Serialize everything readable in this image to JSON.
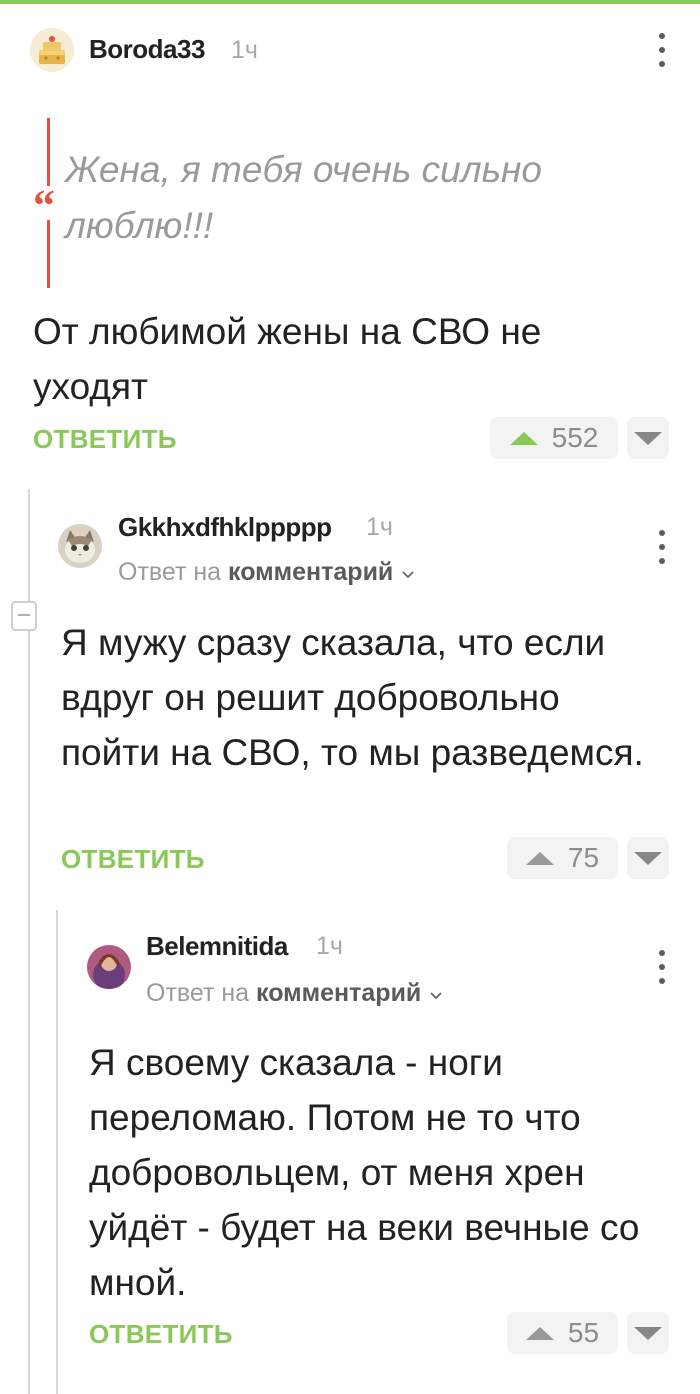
{
  "comments": [
    {
      "username": "Boroda33",
      "time": "1ч",
      "quote": "Жена, я тебя очень сильно люблю!!!",
      "text": "От любимой жены на СВО не уходят",
      "reply_label": "ОТВЕТИТЬ",
      "rating": "552"
    },
    {
      "username": "Gkkhxdfhklppppp",
      "time": "1ч",
      "reply_to_prefix": "Ответ на",
      "reply_to_link": "комментарий",
      "text": "Я мужу сразу сказала, что если вдруг он решит добровольно пойти на СВО, то мы разведемся.",
      "reply_label": "ОТВЕТИТЬ",
      "rating": "75"
    },
    {
      "username": "Belemnitida",
      "time": "1ч",
      "reply_to_prefix": "Ответ на",
      "reply_to_link": "комментарий",
      "text": "Я своему сказала - ноги переломаю. Потом не то что добровольцем, от меня хрен уйдёт - будет на веки вечные со мной.",
      "reply_label": "ОТВЕТИТЬ",
      "rating": "55"
    }
  ],
  "icons": {
    "more": "more-vertical-icon",
    "upvote": "upvote-icon",
    "downvote": "downvote-icon",
    "chevron": "chevron-down-icon",
    "quote": "quote-icon",
    "collapse": "collapse-thread-icon"
  },
  "colors": {
    "accent_green": "#8ac858",
    "quote_red": "#e4513f",
    "muted_grey": "#9a9a9a"
  }
}
